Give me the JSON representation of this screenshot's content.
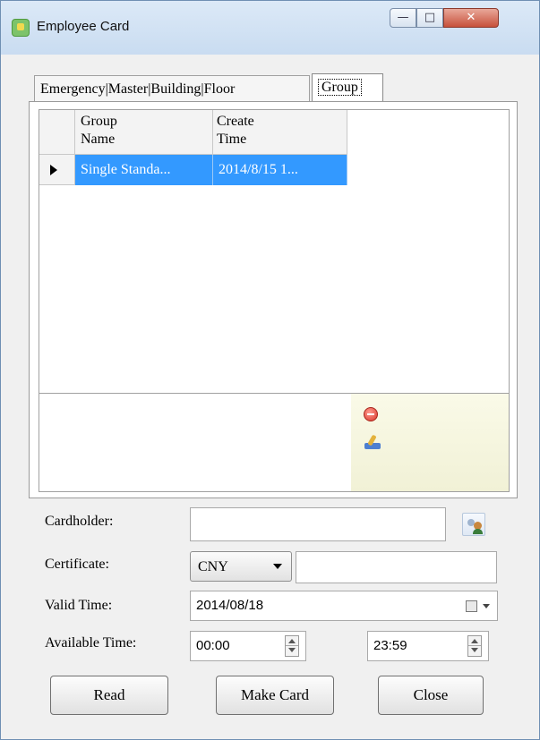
{
  "window": {
    "title": "Employee Card",
    "controls": {
      "minimize": "—",
      "maximize": "□",
      "close": "✕"
    }
  },
  "tabs": [
    {
      "label": "Emergency|Master|Building|Floor",
      "active": false
    },
    {
      "label": "Group",
      "active": true
    }
  ],
  "grid": {
    "columns": [
      "Group\nName",
      "Create\nTime"
    ],
    "col1_line1": "Group",
    "col1_line2": "Name",
    "col2_line1": "Create",
    "col2_line2": "Time",
    "rows": [
      {
        "group_name": "Single Standa...",
        "create_time": "2014/8/15 1..."
      }
    ]
  },
  "side_actions": {
    "remove_icon": "remove-icon",
    "clean_icon": "clean-icon"
  },
  "form": {
    "cardholder_label": "Cardholder:",
    "cardholder_value": "",
    "certificate_label": "Certificate:",
    "certificate_type": "CNY",
    "certificate_value": "",
    "valid_time_label": "Valid Time:",
    "valid_time_value": "2014/08/18",
    "available_time_label": "Available Time:",
    "available_from": "00:00",
    "available_to": "23:59"
  },
  "buttons": {
    "read": "Read",
    "make_card": "Make Card",
    "close": "Close"
  },
  "colors": {
    "selection": "#3399ff",
    "title_bar": "#c9dcf1",
    "close_button": "#c7513b"
  }
}
